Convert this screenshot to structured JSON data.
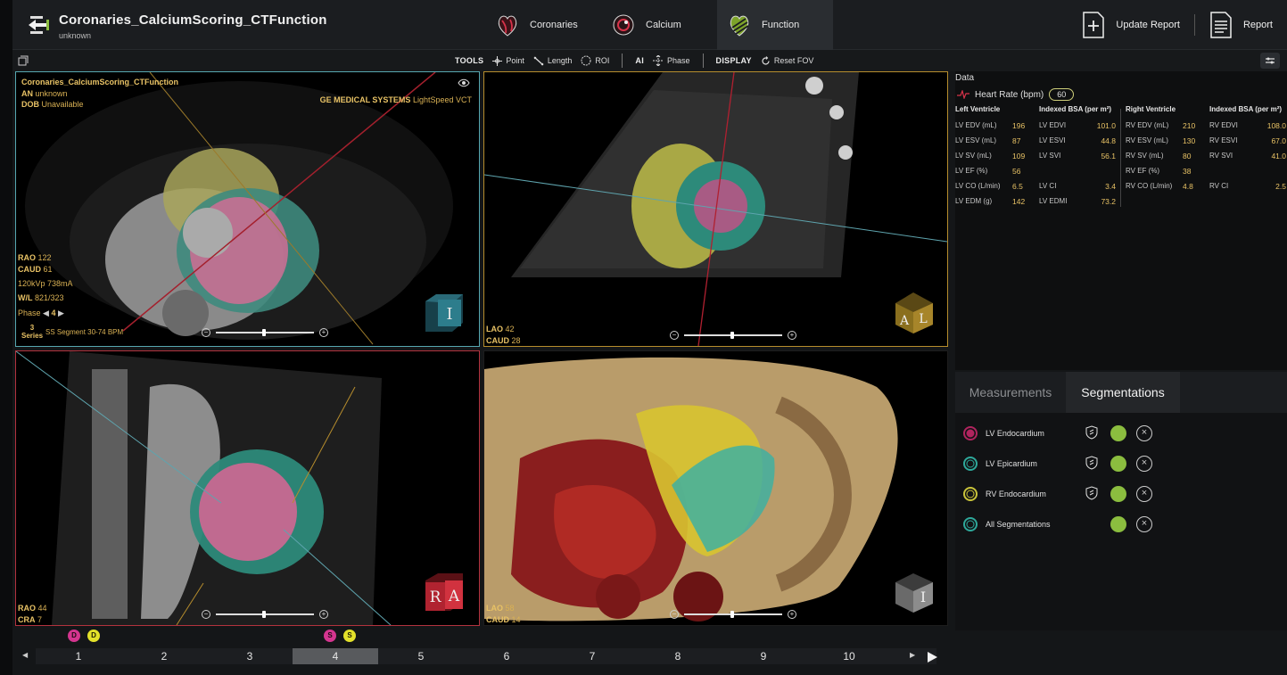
{
  "header": {
    "title": "Coronaries_CalciumScoring_CTFunction",
    "subtitle": "unknown",
    "tabs": [
      {
        "label": "Coronaries",
        "active": false
      },
      {
        "label": "Calcium",
        "active": false
      },
      {
        "label": "Function",
        "active": true
      }
    ],
    "actions": {
      "update_report": "Update Report",
      "report": "Report"
    }
  },
  "toolbar": {
    "tools_label": "TOOLS",
    "point": "Point",
    "length": "Length",
    "roi": "ROI",
    "ai_label": "AI",
    "phase": "Phase",
    "display_label": "DISPLAY",
    "reset_fov": "Reset FOV"
  },
  "viewports": {
    "axial": {
      "series_name": "Coronaries_CalciumScoring_CTFunction",
      "an_label": "AN",
      "an_value": "unknown",
      "dob_label": "DOB",
      "dob_value": "Unavailable",
      "manufacturer": "GE MEDICAL SYSTEMS",
      "model": "LightSpeed VCT",
      "rao_label": "RAO",
      "rao_value": "122",
      "caud_label": "CAUD",
      "caud_value": "61",
      "kvp": "120kVp 738mA",
      "wl_label": "W/L",
      "wl_value": "821/323",
      "phase_label": "Phase",
      "phase_value": "4",
      "series_count": "3",
      "series_label": "Series",
      "series_desc": "SS Segment 30-74 BPM",
      "cube_letters": [
        "Ⅰ"
      ]
    },
    "short_axis": {
      "lao_label": "LAO",
      "lao_value": "42",
      "caud_label": "CAUD",
      "caud_value": "28",
      "cube_letters": [
        "A",
        "L"
      ]
    },
    "coronal": {
      "rao_label": "RAO",
      "rao_value": "44",
      "cra_label": "CRA",
      "cra_value": "7",
      "cube_letters": [
        "R",
        "A"
      ]
    },
    "volume": {
      "lao_label": "LAO",
      "lao_value": "58",
      "caud_label": "CAUD",
      "caud_value": "14",
      "cube_letters": [
        "Ⅰ"
      ]
    }
  },
  "data_panel": {
    "title": "Data",
    "heart_rate_label": "Heart Rate (bpm)",
    "heart_rate_value": "60",
    "lv_header": "Left Ventricle",
    "lv_bsa_header": "Indexed BSA (per m²)",
    "rv_header": "Right Ventricle",
    "rv_bsa_header": "Indexed BSA (per m²)",
    "lv_rows": [
      {
        "label": "LV EDV (mL)",
        "value": "196",
        "idx_label": "LV EDVI",
        "idx_value": "101.0"
      },
      {
        "label": "LV ESV (mL)",
        "value": "87",
        "idx_label": "LV ESVI",
        "idx_value": "44.8"
      },
      {
        "label": "LV SV (mL)",
        "value": "109",
        "idx_label": "LV SVI",
        "idx_value": "56.1"
      },
      {
        "label": "LV EF (%)",
        "value": "56",
        "idx_label": "",
        "idx_value": ""
      },
      {
        "label": "LV CO (L/min)",
        "value": "6.5",
        "idx_label": "LV CI",
        "idx_value": "3.4"
      },
      {
        "label": "LV EDM (g)",
        "value": "142",
        "idx_label": "LV EDMI",
        "idx_value": "73.2"
      }
    ],
    "rv_rows": [
      {
        "label": "RV EDV (mL)",
        "value": "210",
        "idx_label": "RV EDVI",
        "idx_value": "108.0"
      },
      {
        "label": "RV ESV (mL)",
        "value": "130",
        "idx_label": "RV ESVI",
        "idx_value": "67.0"
      },
      {
        "label": "RV SV (mL)",
        "value": "80",
        "idx_label": "RV SVI",
        "idx_value": "41.0"
      },
      {
        "label": "RV EF (%)",
        "value": "38",
        "idx_label": "",
        "idx_value": ""
      },
      {
        "label": "RV CO (L/min)",
        "value": "4.8",
        "idx_label": "RV CI",
        "idx_value": "2.5"
      }
    ]
  },
  "segmentation_panel": {
    "tabs": [
      {
        "label": "Measurements",
        "active": false
      },
      {
        "label": "Segmentations",
        "active": true
      }
    ],
    "items": [
      {
        "label": "LV Endocardium",
        "color": "#b0245e"
      },
      {
        "label": "LV Epicardium",
        "color": "#2ea89a"
      },
      {
        "label": "RV Endocardium",
        "color": "#c9c33a"
      },
      {
        "label": "All Segmentations",
        "color": "#2ea89a"
      }
    ]
  },
  "timeline": {
    "markers": [
      {
        "letter": "D",
        "kind": "pink"
      },
      {
        "letter": "D",
        "kind": "yellow"
      },
      {
        "letter": "S",
        "kind": "pink"
      },
      {
        "letter": "S",
        "kind": "yellow"
      }
    ],
    "phases": [
      "1",
      "2",
      "3",
      "4",
      "5",
      "6",
      "7",
      "8",
      "9",
      "10"
    ],
    "active_phase": "4"
  },
  "colors": {
    "accent_cyan": "#56a7b0",
    "accent_gold": "#b68d2d",
    "accent_red": "#b3323e",
    "overlay_text": "#d9b154",
    "eye_green": "#8bbd3f"
  }
}
